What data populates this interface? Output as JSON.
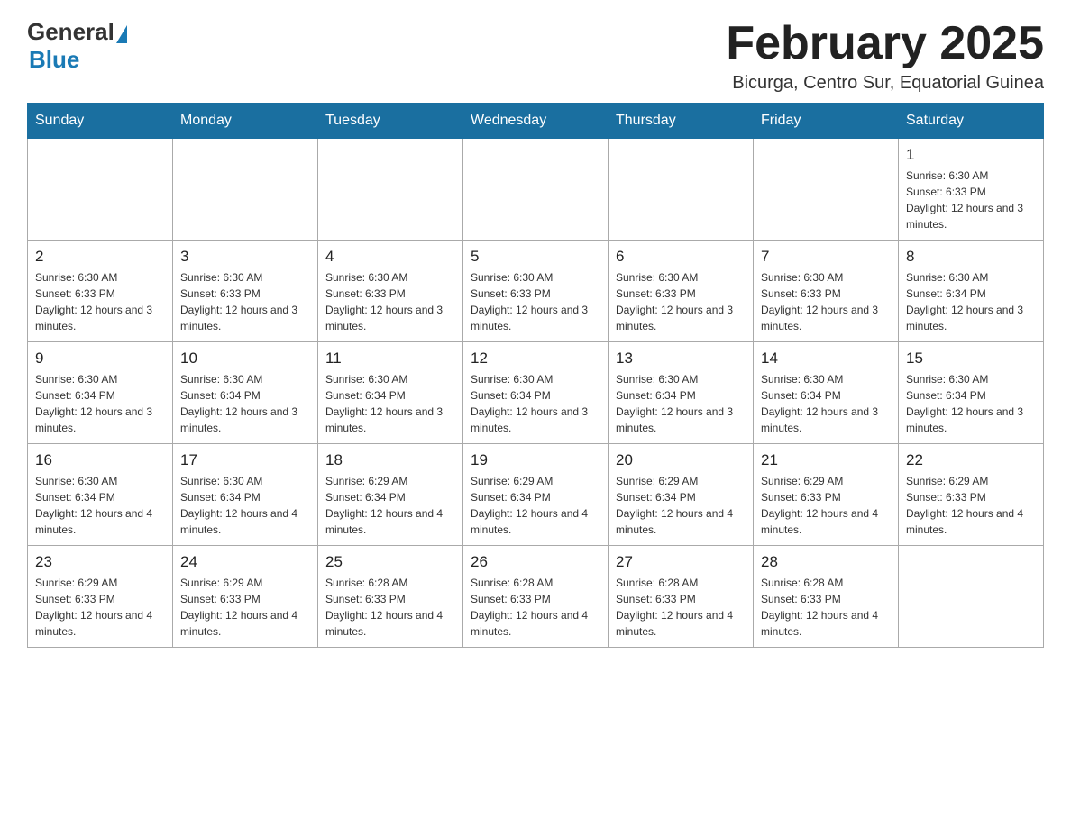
{
  "header": {
    "logo_general": "General",
    "logo_blue": "Blue",
    "month_title": "February 2025",
    "location": "Bicurga, Centro Sur, Equatorial Guinea"
  },
  "weekdays": [
    "Sunday",
    "Monday",
    "Tuesday",
    "Wednesday",
    "Thursday",
    "Friday",
    "Saturday"
  ],
  "weeks": [
    [
      {
        "day": "",
        "sunrise": "",
        "sunset": "",
        "daylight": ""
      },
      {
        "day": "",
        "sunrise": "",
        "sunset": "",
        "daylight": ""
      },
      {
        "day": "",
        "sunrise": "",
        "sunset": "",
        "daylight": ""
      },
      {
        "day": "",
        "sunrise": "",
        "sunset": "",
        "daylight": ""
      },
      {
        "day": "",
        "sunrise": "",
        "sunset": "",
        "daylight": ""
      },
      {
        "day": "",
        "sunrise": "",
        "sunset": "",
        "daylight": ""
      },
      {
        "day": "1",
        "sunrise": "Sunrise: 6:30 AM",
        "sunset": "Sunset: 6:33 PM",
        "daylight": "Daylight: 12 hours and 3 minutes."
      }
    ],
    [
      {
        "day": "2",
        "sunrise": "Sunrise: 6:30 AM",
        "sunset": "Sunset: 6:33 PM",
        "daylight": "Daylight: 12 hours and 3 minutes."
      },
      {
        "day": "3",
        "sunrise": "Sunrise: 6:30 AM",
        "sunset": "Sunset: 6:33 PM",
        "daylight": "Daylight: 12 hours and 3 minutes."
      },
      {
        "day": "4",
        "sunrise": "Sunrise: 6:30 AM",
        "sunset": "Sunset: 6:33 PM",
        "daylight": "Daylight: 12 hours and 3 minutes."
      },
      {
        "day": "5",
        "sunrise": "Sunrise: 6:30 AM",
        "sunset": "Sunset: 6:33 PM",
        "daylight": "Daylight: 12 hours and 3 minutes."
      },
      {
        "day": "6",
        "sunrise": "Sunrise: 6:30 AM",
        "sunset": "Sunset: 6:33 PM",
        "daylight": "Daylight: 12 hours and 3 minutes."
      },
      {
        "day": "7",
        "sunrise": "Sunrise: 6:30 AM",
        "sunset": "Sunset: 6:33 PM",
        "daylight": "Daylight: 12 hours and 3 minutes."
      },
      {
        "day": "8",
        "sunrise": "Sunrise: 6:30 AM",
        "sunset": "Sunset: 6:34 PM",
        "daylight": "Daylight: 12 hours and 3 minutes."
      }
    ],
    [
      {
        "day": "9",
        "sunrise": "Sunrise: 6:30 AM",
        "sunset": "Sunset: 6:34 PM",
        "daylight": "Daylight: 12 hours and 3 minutes."
      },
      {
        "day": "10",
        "sunrise": "Sunrise: 6:30 AM",
        "sunset": "Sunset: 6:34 PM",
        "daylight": "Daylight: 12 hours and 3 minutes."
      },
      {
        "day": "11",
        "sunrise": "Sunrise: 6:30 AM",
        "sunset": "Sunset: 6:34 PM",
        "daylight": "Daylight: 12 hours and 3 minutes."
      },
      {
        "day": "12",
        "sunrise": "Sunrise: 6:30 AM",
        "sunset": "Sunset: 6:34 PM",
        "daylight": "Daylight: 12 hours and 3 minutes."
      },
      {
        "day": "13",
        "sunrise": "Sunrise: 6:30 AM",
        "sunset": "Sunset: 6:34 PM",
        "daylight": "Daylight: 12 hours and 3 minutes."
      },
      {
        "day": "14",
        "sunrise": "Sunrise: 6:30 AM",
        "sunset": "Sunset: 6:34 PM",
        "daylight": "Daylight: 12 hours and 3 minutes."
      },
      {
        "day": "15",
        "sunrise": "Sunrise: 6:30 AM",
        "sunset": "Sunset: 6:34 PM",
        "daylight": "Daylight: 12 hours and 3 minutes."
      }
    ],
    [
      {
        "day": "16",
        "sunrise": "Sunrise: 6:30 AM",
        "sunset": "Sunset: 6:34 PM",
        "daylight": "Daylight: 12 hours and 4 minutes."
      },
      {
        "day": "17",
        "sunrise": "Sunrise: 6:30 AM",
        "sunset": "Sunset: 6:34 PM",
        "daylight": "Daylight: 12 hours and 4 minutes."
      },
      {
        "day": "18",
        "sunrise": "Sunrise: 6:29 AM",
        "sunset": "Sunset: 6:34 PM",
        "daylight": "Daylight: 12 hours and 4 minutes."
      },
      {
        "day": "19",
        "sunrise": "Sunrise: 6:29 AM",
        "sunset": "Sunset: 6:34 PM",
        "daylight": "Daylight: 12 hours and 4 minutes."
      },
      {
        "day": "20",
        "sunrise": "Sunrise: 6:29 AM",
        "sunset": "Sunset: 6:34 PM",
        "daylight": "Daylight: 12 hours and 4 minutes."
      },
      {
        "day": "21",
        "sunrise": "Sunrise: 6:29 AM",
        "sunset": "Sunset: 6:33 PM",
        "daylight": "Daylight: 12 hours and 4 minutes."
      },
      {
        "day": "22",
        "sunrise": "Sunrise: 6:29 AM",
        "sunset": "Sunset: 6:33 PM",
        "daylight": "Daylight: 12 hours and 4 minutes."
      }
    ],
    [
      {
        "day": "23",
        "sunrise": "Sunrise: 6:29 AM",
        "sunset": "Sunset: 6:33 PM",
        "daylight": "Daylight: 12 hours and 4 minutes."
      },
      {
        "day": "24",
        "sunrise": "Sunrise: 6:29 AM",
        "sunset": "Sunset: 6:33 PM",
        "daylight": "Daylight: 12 hours and 4 minutes."
      },
      {
        "day": "25",
        "sunrise": "Sunrise: 6:28 AM",
        "sunset": "Sunset: 6:33 PM",
        "daylight": "Daylight: 12 hours and 4 minutes."
      },
      {
        "day": "26",
        "sunrise": "Sunrise: 6:28 AM",
        "sunset": "Sunset: 6:33 PM",
        "daylight": "Daylight: 12 hours and 4 minutes."
      },
      {
        "day": "27",
        "sunrise": "Sunrise: 6:28 AM",
        "sunset": "Sunset: 6:33 PM",
        "daylight": "Daylight: 12 hours and 4 minutes."
      },
      {
        "day": "28",
        "sunrise": "Sunrise: 6:28 AM",
        "sunset": "Sunset: 6:33 PM",
        "daylight": "Daylight: 12 hours and 4 minutes."
      },
      {
        "day": "",
        "sunrise": "",
        "sunset": "",
        "daylight": ""
      }
    ]
  ]
}
